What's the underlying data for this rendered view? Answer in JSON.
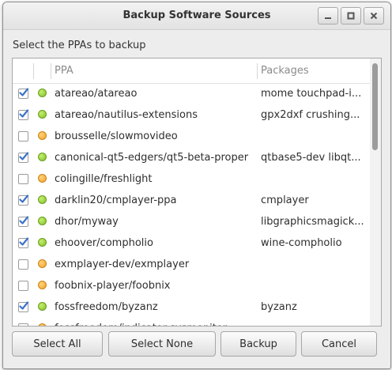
{
  "window": {
    "title": "Backup Software Sources",
    "controls": [
      "minimize-icon",
      "maximize-icon",
      "close-icon"
    ]
  },
  "prompt": "Select the PPAs to backup",
  "list": {
    "columns": {
      "ppa": "PPA",
      "packages": "Packages"
    },
    "rows": [
      {
        "checked": true,
        "status": "green",
        "ppa": "atareao/atareao",
        "packages": "mome touchpad-i..."
      },
      {
        "checked": true,
        "status": "green",
        "ppa": "atareao/nautilus-extensions",
        "packages": "gpx2dxf crushing..."
      },
      {
        "checked": false,
        "status": "orange",
        "ppa": "brousselle/slowmovideo",
        "packages": ""
      },
      {
        "checked": true,
        "status": "green",
        "ppa": "canonical-qt5-edgers/qt5-beta-proper",
        "packages": "qtbase5-dev libqt..."
      },
      {
        "checked": false,
        "status": "orange",
        "ppa": "colingille/freshlight",
        "packages": ""
      },
      {
        "checked": true,
        "status": "green",
        "ppa": "darklin20/cmplayer-ppa",
        "packages": "cmplayer"
      },
      {
        "checked": true,
        "status": "green",
        "ppa": "dhor/myway",
        "packages": "libgraphicsmagick..."
      },
      {
        "checked": true,
        "status": "green",
        "ppa": "ehoover/compholio",
        "packages": "wine-compholio"
      },
      {
        "checked": false,
        "status": "orange",
        "ppa": "exmplayer-dev/exmplayer",
        "packages": ""
      },
      {
        "checked": false,
        "status": "orange",
        "ppa": "foobnix-player/foobnix",
        "packages": ""
      },
      {
        "checked": true,
        "status": "green",
        "ppa": "fossfreedom/byzanz",
        "packages": "byzanz"
      },
      {
        "checked": false,
        "status": "orange",
        "ppa": "fossfreedom/indicator-sysmonitor",
        "packages": ""
      }
    ]
  },
  "buttons": {
    "select_all": "Select All",
    "select_none": "Select None",
    "backup": "Backup",
    "cancel": "Cancel"
  },
  "colors": {
    "green": "#8cc63f",
    "orange": "#f0a32c",
    "check": "#3c72c8"
  }
}
